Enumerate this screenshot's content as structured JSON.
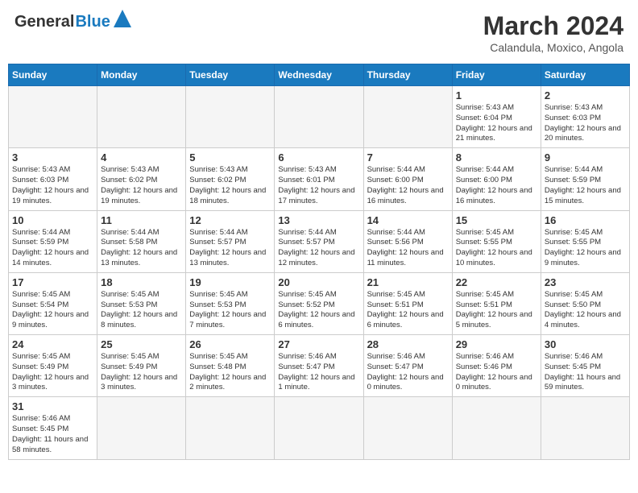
{
  "header": {
    "logo_text_general": "General",
    "logo_text_blue": "Blue",
    "month_title": "March 2024",
    "subtitle": "Calandula, Moxico, Angola"
  },
  "days_of_week": [
    "Sunday",
    "Monday",
    "Tuesday",
    "Wednesday",
    "Thursday",
    "Friday",
    "Saturday"
  ],
  "weeks": [
    [
      {
        "day": "",
        "info": ""
      },
      {
        "day": "",
        "info": ""
      },
      {
        "day": "",
        "info": ""
      },
      {
        "day": "",
        "info": ""
      },
      {
        "day": "",
        "info": ""
      },
      {
        "day": "1",
        "info": "Sunrise: 5:43 AM\nSunset: 6:04 PM\nDaylight: 12 hours and 21 minutes."
      },
      {
        "day": "2",
        "info": "Sunrise: 5:43 AM\nSunset: 6:03 PM\nDaylight: 12 hours and 20 minutes."
      }
    ],
    [
      {
        "day": "3",
        "info": "Sunrise: 5:43 AM\nSunset: 6:03 PM\nDaylight: 12 hours and 19 minutes."
      },
      {
        "day": "4",
        "info": "Sunrise: 5:43 AM\nSunset: 6:02 PM\nDaylight: 12 hours and 19 minutes."
      },
      {
        "day": "5",
        "info": "Sunrise: 5:43 AM\nSunset: 6:02 PM\nDaylight: 12 hours and 18 minutes."
      },
      {
        "day": "6",
        "info": "Sunrise: 5:43 AM\nSunset: 6:01 PM\nDaylight: 12 hours and 17 minutes."
      },
      {
        "day": "7",
        "info": "Sunrise: 5:44 AM\nSunset: 6:00 PM\nDaylight: 12 hours and 16 minutes."
      },
      {
        "day": "8",
        "info": "Sunrise: 5:44 AM\nSunset: 6:00 PM\nDaylight: 12 hours and 16 minutes."
      },
      {
        "day": "9",
        "info": "Sunrise: 5:44 AM\nSunset: 5:59 PM\nDaylight: 12 hours and 15 minutes."
      }
    ],
    [
      {
        "day": "10",
        "info": "Sunrise: 5:44 AM\nSunset: 5:59 PM\nDaylight: 12 hours and 14 minutes."
      },
      {
        "day": "11",
        "info": "Sunrise: 5:44 AM\nSunset: 5:58 PM\nDaylight: 12 hours and 13 minutes."
      },
      {
        "day": "12",
        "info": "Sunrise: 5:44 AM\nSunset: 5:57 PM\nDaylight: 12 hours and 13 minutes."
      },
      {
        "day": "13",
        "info": "Sunrise: 5:44 AM\nSunset: 5:57 PM\nDaylight: 12 hours and 12 minutes."
      },
      {
        "day": "14",
        "info": "Sunrise: 5:44 AM\nSunset: 5:56 PM\nDaylight: 12 hours and 11 minutes."
      },
      {
        "day": "15",
        "info": "Sunrise: 5:45 AM\nSunset: 5:55 PM\nDaylight: 12 hours and 10 minutes."
      },
      {
        "day": "16",
        "info": "Sunrise: 5:45 AM\nSunset: 5:55 PM\nDaylight: 12 hours and 9 minutes."
      }
    ],
    [
      {
        "day": "17",
        "info": "Sunrise: 5:45 AM\nSunset: 5:54 PM\nDaylight: 12 hours and 9 minutes."
      },
      {
        "day": "18",
        "info": "Sunrise: 5:45 AM\nSunset: 5:53 PM\nDaylight: 12 hours and 8 minutes."
      },
      {
        "day": "19",
        "info": "Sunrise: 5:45 AM\nSunset: 5:53 PM\nDaylight: 12 hours and 7 minutes."
      },
      {
        "day": "20",
        "info": "Sunrise: 5:45 AM\nSunset: 5:52 PM\nDaylight: 12 hours and 6 minutes."
      },
      {
        "day": "21",
        "info": "Sunrise: 5:45 AM\nSunset: 5:51 PM\nDaylight: 12 hours and 6 minutes."
      },
      {
        "day": "22",
        "info": "Sunrise: 5:45 AM\nSunset: 5:51 PM\nDaylight: 12 hours and 5 minutes."
      },
      {
        "day": "23",
        "info": "Sunrise: 5:45 AM\nSunset: 5:50 PM\nDaylight: 12 hours and 4 minutes."
      }
    ],
    [
      {
        "day": "24",
        "info": "Sunrise: 5:45 AM\nSunset: 5:49 PM\nDaylight: 12 hours and 3 minutes."
      },
      {
        "day": "25",
        "info": "Sunrise: 5:45 AM\nSunset: 5:49 PM\nDaylight: 12 hours and 3 minutes."
      },
      {
        "day": "26",
        "info": "Sunrise: 5:45 AM\nSunset: 5:48 PM\nDaylight: 12 hours and 2 minutes."
      },
      {
        "day": "27",
        "info": "Sunrise: 5:46 AM\nSunset: 5:47 PM\nDaylight: 12 hours and 1 minute."
      },
      {
        "day": "28",
        "info": "Sunrise: 5:46 AM\nSunset: 5:47 PM\nDaylight: 12 hours and 0 minutes."
      },
      {
        "day": "29",
        "info": "Sunrise: 5:46 AM\nSunset: 5:46 PM\nDaylight: 12 hours and 0 minutes."
      },
      {
        "day": "30",
        "info": "Sunrise: 5:46 AM\nSunset: 5:45 PM\nDaylight: 11 hours and 59 minutes."
      }
    ],
    [
      {
        "day": "31",
        "info": "Sunrise: 5:46 AM\nSunset: 5:45 PM\nDaylight: 11 hours and 58 minutes."
      },
      {
        "day": "",
        "info": ""
      },
      {
        "day": "",
        "info": ""
      },
      {
        "day": "",
        "info": ""
      },
      {
        "day": "",
        "info": ""
      },
      {
        "day": "",
        "info": ""
      },
      {
        "day": "",
        "info": ""
      }
    ]
  ]
}
